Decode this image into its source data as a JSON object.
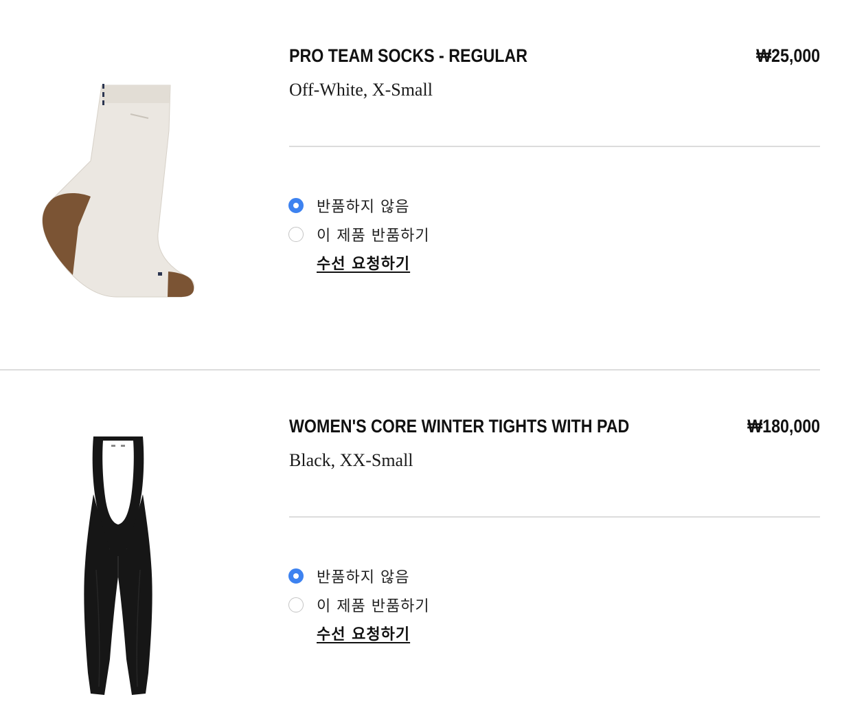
{
  "items": [
    {
      "name": "PRO TEAM SOCKS - REGULAR",
      "price": "₩25,000",
      "variant": "Off-White, X-Small",
      "image_icon": "socks-image",
      "options": {
        "keep_label": "반품하지 않음",
        "return_label": "이 제품 반품하기",
        "selected": "keep"
      },
      "repair_label": "수선 요청하기"
    },
    {
      "name": "WOMEN'S CORE WINTER TIGHTS WITH PAD",
      "price": "₩180,000",
      "variant": "Black, XX-Small",
      "image_icon": "bib-tights-image",
      "options": {
        "keep_label": "반품하지 않음",
        "return_label": "이 제품 반품하기",
        "selected": "keep"
      },
      "repair_label": "수선 요청하기"
    }
  ],
  "colors": {
    "radio_selected": "#3d82f0",
    "divider": "#dcdcdc",
    "text": "#111111",
    "sock_body": "#ebe7e1",
    "sock_accent": "#7b5434",
    "tights": "#161616"
  }
}
